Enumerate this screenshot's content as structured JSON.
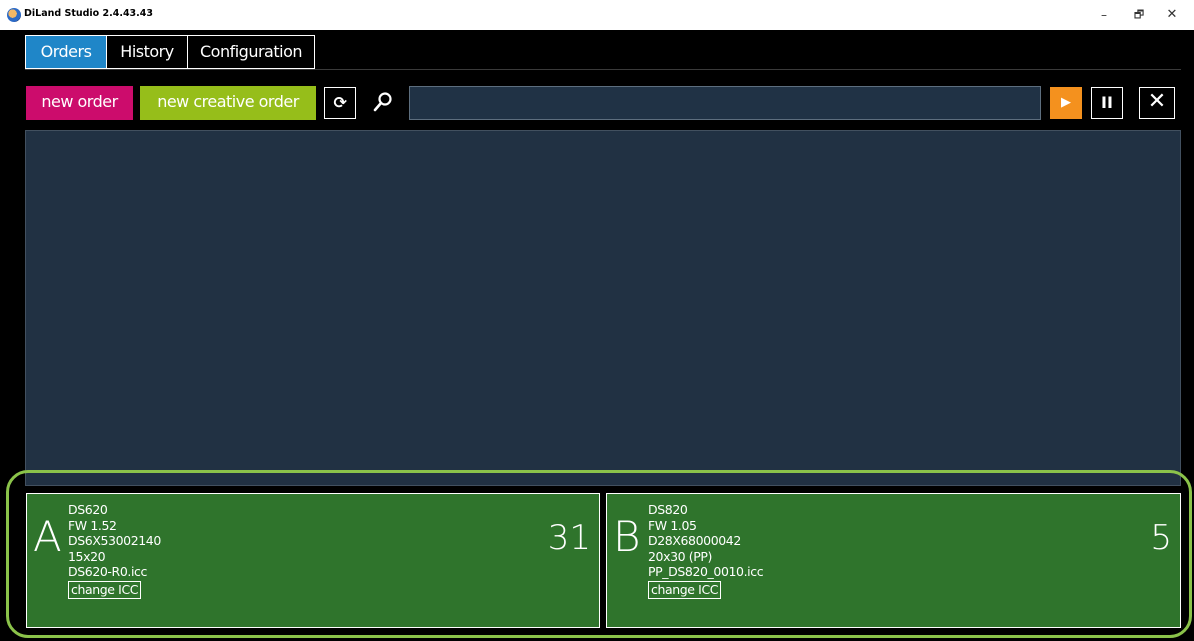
{
  "window": {
    "title": "DiLand Studio 2.4.43.43",
    "controls": {
      "minimize": "–",
      "maximize": "🗗",
      "close": "✕"
    }
  },
  "tabs": [
    {
      "label": "Orders",
      "active": true
    },
    {
      "label": "History",
      "active": false
    },
    {
      "label": "Configuration",
      "active": false
    }
  ],
  "toolbar": {
    "new_order_label": "new order",
    "new_creative_order_label": "new creative order",
    "refresh_icon": "refresh-icon",
    "search_icon": "search-icon",
    "search_value": "",
    "play_glyph": "▶",
    "pause_glyph": "II",
    "stop_glyph": "✕"
  },
  "colors": {
    "tab_active": "#1f86c8",
    "new_order": "#cc0c6c",
    "new_creative_order": "#96be1a",
    "play": "#f4911e",
    "printer_bg": "#2f742c",
    "highlight": "#8bc34a",
    "orders_bg": "#213143"
  },
  "printers": [
    {
      "slot": "A",
      "model": "DS620",
      "firmware": "FW 1.52",
      "serial": "DS6X53002140",
      "media": "15x20",
      "icc": "DS620-R0.icc",
      "change_icc_label": "change ICC",
      "count": "31"
    },
    {
      "slot": "B",
      "model": "DS820",
      "firmware": "FW 1.05",
      "serial": "D28X68000042",
      "media": "20x30 (PP)",
      "icc": "PP_DS820_0010.icc",
      "change_icc_label": "change ICC",
      "count": "5"
    }
  ]
}
